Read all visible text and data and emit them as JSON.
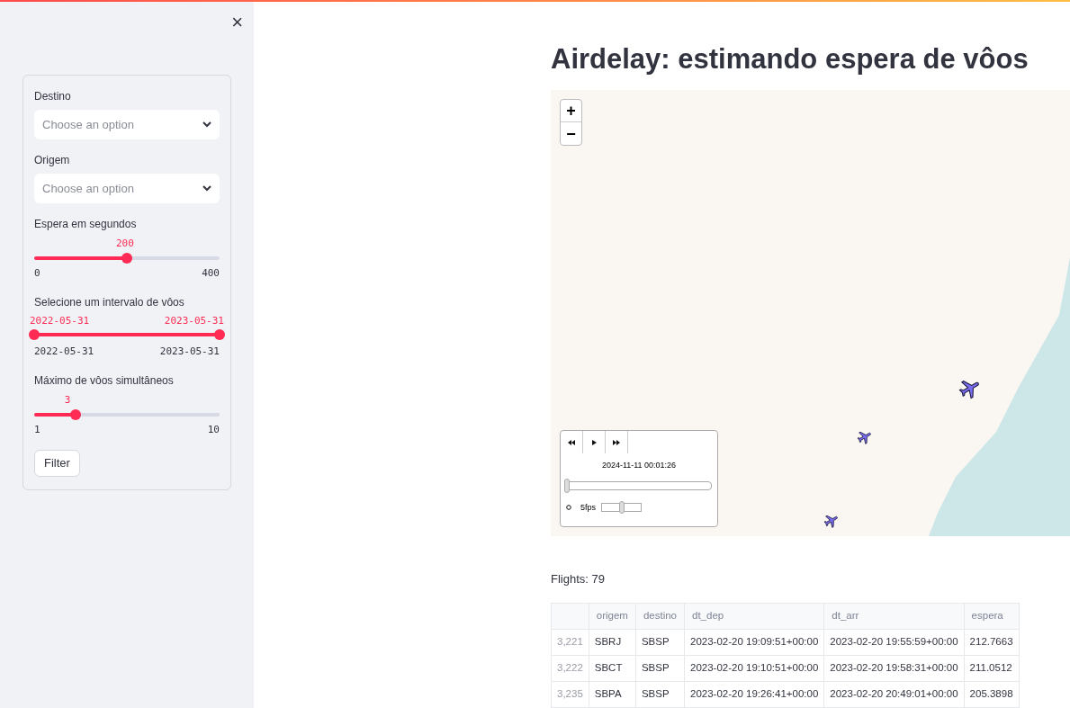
{
  "sidebar": {
    "close_icon": "×",
    "filters": [
      {
        "kind": "select",
        "label": "Destino",
        "placeholder": "Choose an option"
      },
      {
        "kind": "select",
        "label": "Origem",
        "placeholder": "Choose an option"
      },
      {
        "kind": "slider",
        "label": "Espera em segundos",
        "value": "200",
        "level": 0.5,
        "min": "0",
        "max": "400"
      },
      {
        "kind": "range",
        "label": "Selecione um intervalo de vôos",
        "thumbs": [
          {
            "value": "2022-05-31",
            "level": 0
          },
          {
            "value": "2023-05-31",
            "level": 1
          }
        ],
        "min": "2022-05-31",
        "max": "2023-05-31"
      },
      {
        "kind": "slider",
        "label": "Máximo de vôos simultâneos",
        "value": "3",
        "level": 0.222,
        "min": "1",
        "max": "10"
      }
    ],
    "button": "Filter"
  },
  "title": "Airdelay: estimando espera de vôos",
  "map": {
    "zoom_in": "+",
    "zoom_out": "−",
    "player": {
      "timestamp": "2024-11-11 00:01:26",
      "time_slider": {
        "level": 0
      },
      "fps": "5fps",
      "fps_slider": {
        "level": 0.5
      }
    }
  },
  "flights_label": "Flights: 79",
  "table": {
    "columns": [
      "origem",
      "destino",
      "dt_dep",
      "dt_arr",
      "espera"
    ],
    "rows": [
      {
        "index": "3,221",
        "cells": [
          "SBRJ",
          "SBSP",
          "2023-02-20 19:09:51+00:00",
          "2023-02-20 19:55:59+00:00",
          "212.7663"
        ]
      },
      {
        "index": "3,222",
        "cells": [
          "SBCT",
          "SBSP",
          "2023-02-20 19:10:51+00:00",
          "2023-02-20 19:58:31+00:00",
          "211.0512"
        ]
      },
      {
        "index": "3,235",
        "cells": [
          "SBPA",
          "SBSP",
          "2023-02-20 19:26:41+00:00",
          "2023-02-20 20:49:01+00:00",
          "205.3898"
        ]
      }
    ]
  }
}
